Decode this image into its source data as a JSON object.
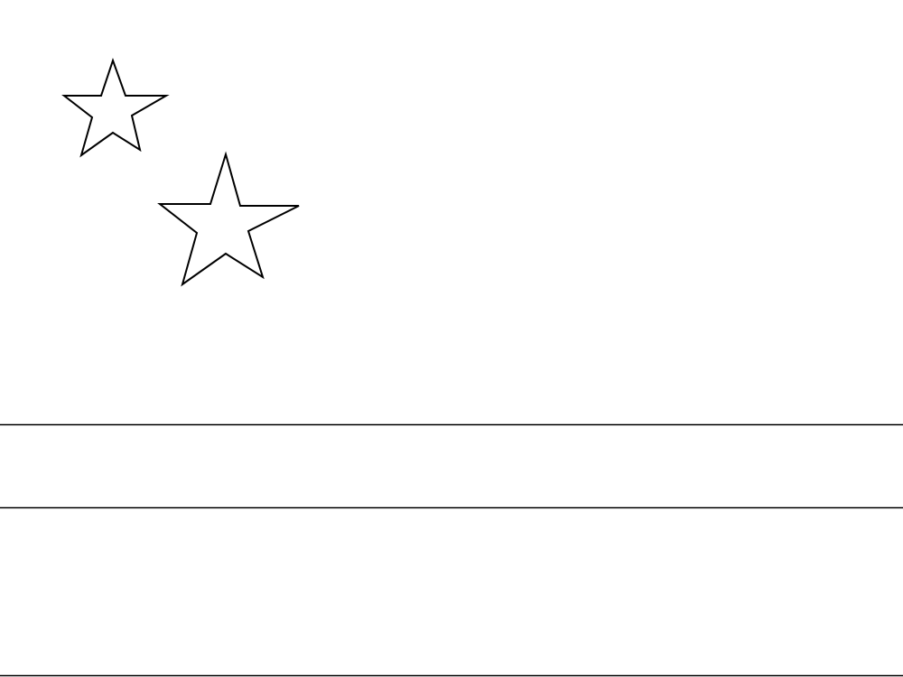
{
  "figure": {
    "description_type": "flag-outline-drawing",
    "stroke_color": "#000000",
    "fill_color": "#ffffff",
    "background_color": "#ffffff",
    "stars_count": 2,
    "horizontal_lines_count": 3,
    "icons": [
      "small-star-icon",
      "large-star-icon"
    ]
  }
}
